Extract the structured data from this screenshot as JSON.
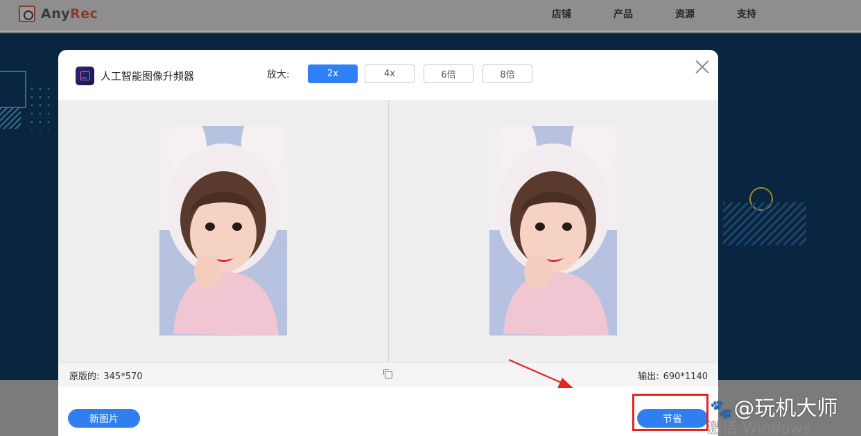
{
  "site": {
    "logo": {
      "part1": "Any",
      "part2": "Rec"
    },
    "nav": [
      {
        "label": "店铺"
      },
      {
        "label": "产品"
      },
      {
        "label": "资源"
      },
      {
        "label": "支持"
      }
    ]
  },
  "modal": {
    "title": "人工智能图像升频器",
    "scale_label": "放大:",
    "scale_options": [
      {
        "label": "2x",
        "active": true
      },
      {
        "label": "4x",
        "active": false
      },
      {
        "label": "6倍",
        "active": false
      },
      {
        "label": "8倍",
        "active": false
      }
    ],
    "original_label": "原版的:",
    "original_size": "345*570",
    "output_label": "输出:",
    "output_size": "690*1140",
    "new_image_button": "新图片",
    "save_button": "节省"
  },
  "overlay": {
    "watermark": "@玩机大师",
    "activate_text": "激活 Windows"
  },
  "colors": {
    "accent": "#2f80f5",
    "hero_bg": "#0a2540",
    "annotation": "#e5231f"
  }
}
